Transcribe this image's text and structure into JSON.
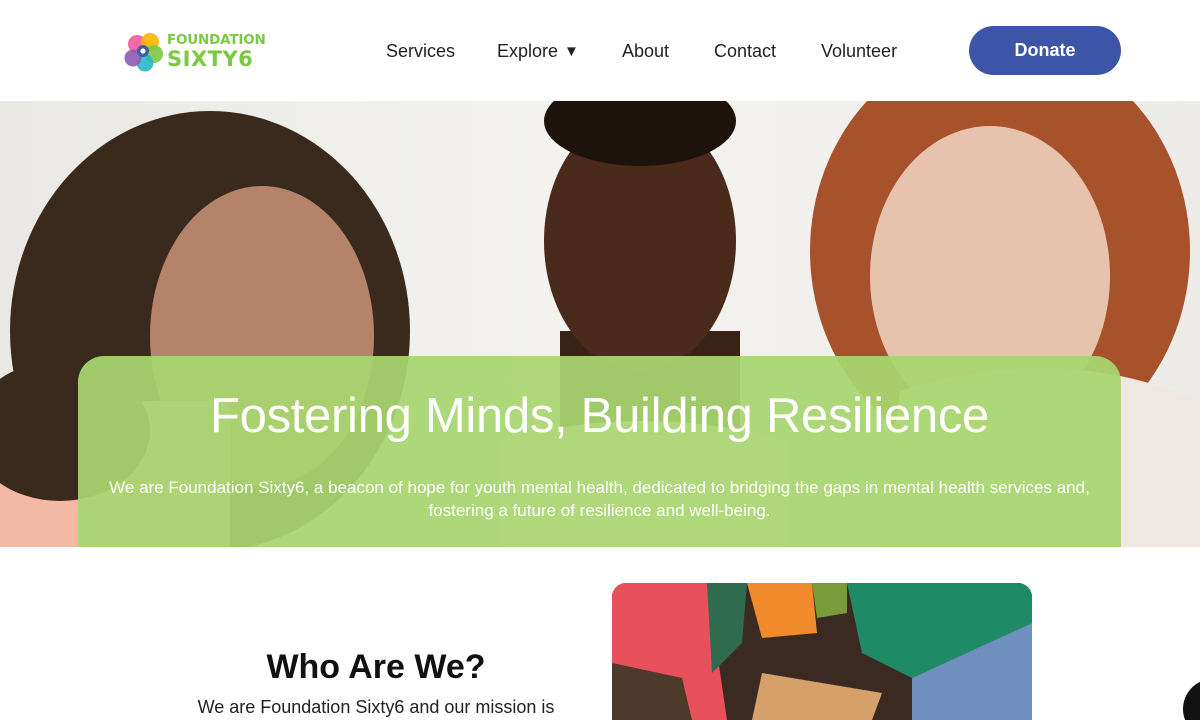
{
  "brand": {
    "logo_top": "FOUNDATION",
    "logo_bottom": "SIXTY6",
    "logo_color": "#7ac943",
    "logo_mark_colors": [
      "#f05a9b",
      "#3d55a6",
      "#f7b500",
      "#7ac943",
      "#8c5bb5",
      "#27b8c9"
    ]
  },
  "nav": {
    "items": [
      {
        "label": "Services"
      },
      {
        "label": "Explore"
      },
      {
        "label": "About"
      },
      {
        "label": "Contact"
      },
      {
        "label": "Volunteer"
      }
    ],
    "explore_caret": "▼"
  },
  "donate_label": "Donate",
  "accent_color": "#3d55a6",
  "hero": {
    "title": "Fostering Minds, Building Resilience",
    "subtitle": "We are Foundation Sixty6, a beacon of hope for youth mental health, dedicated to bridging the gaps in mental health services and, fostering a future of resilience and well-being.",
    "card_color": "#a8d670"
  },
  "about": {
    "title": "Who Are We?",
    "text": "We are Foundation Sixty6 and our mission is"
  }
}
